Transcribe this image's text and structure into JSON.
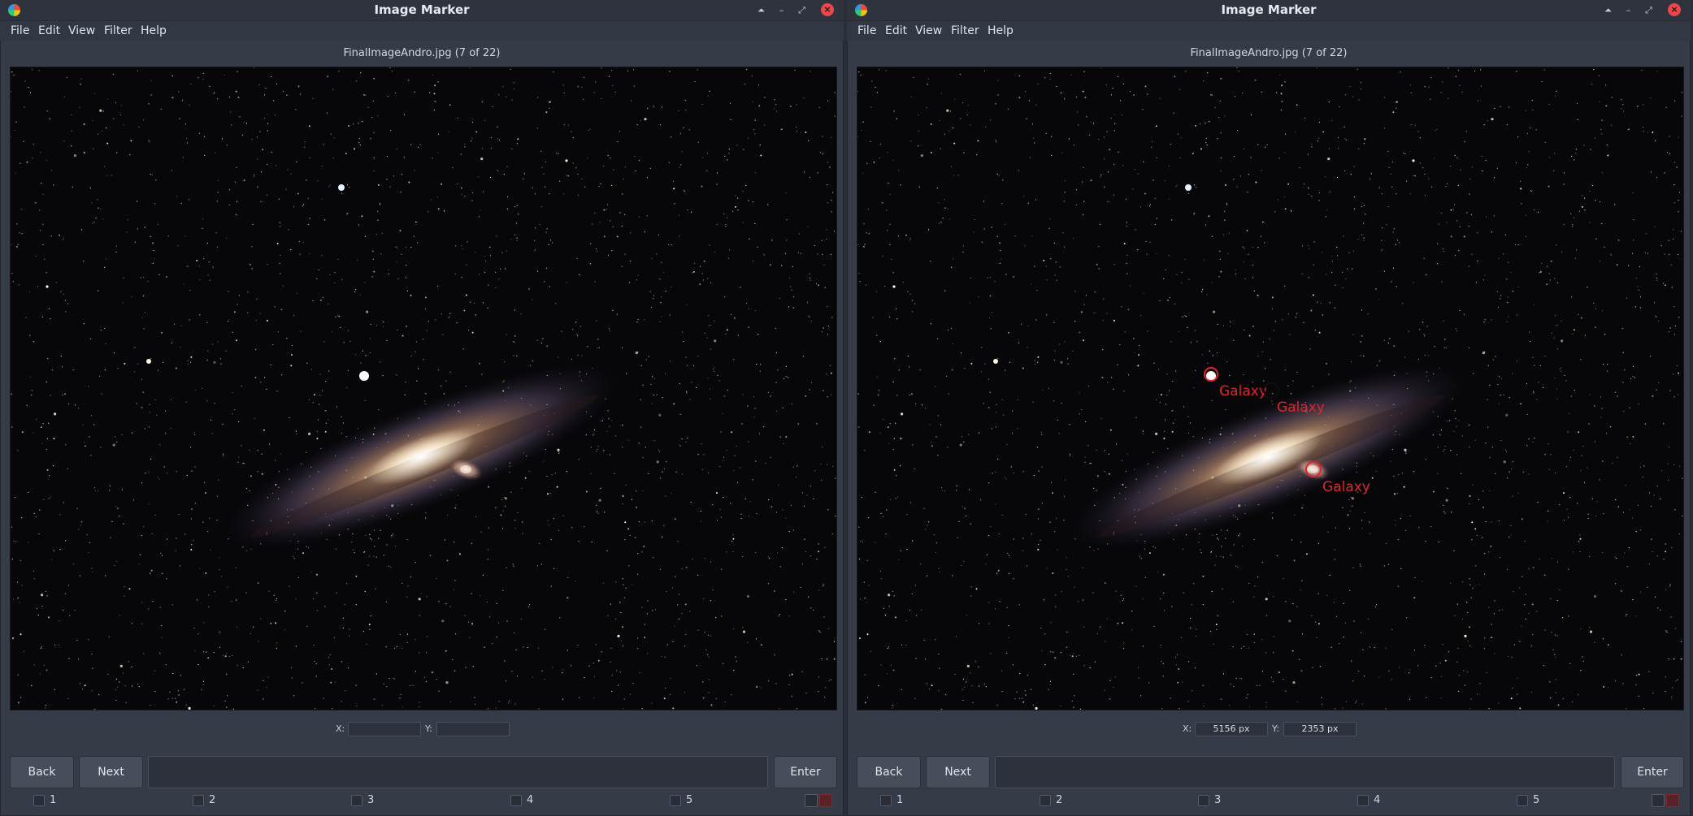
{
  "left_window": {
    "title": "Image Marker",
    "menu": [
      "File",
      "Edit",
      "View",
      "Filter",
      "Help"
    ],
    "filename": "FinalImageAndro.jpg (7 of 22)",
    "coords": {
      "x_label": "X:",
      "y_label": "Y:",
      "x_value": "",
      "y_value": ""
    },
    "buttons": {
      "back": "Back",
      "next": "Next",
      "enter": "Enter"
    },
    "checkboxes": [
      "1",
      "2",
      "3",
      "4",
      "5"
    ]
  },
  "right_window": {
    "title": "Image Marker",
    "menu": [
      "File",
      "Edit",
      "View",
      "Filter",
      "Help"
    ],
    "filename": "FinalImageAndro.jpg (7 of 22)",
    "coords": {
      "x_label": "X:",
      "y_label": "Y:",
      "x_value": "5156 px",
      "y_value": "2353 px"
    },
    "buttons": {
      "back": "Back",
      "next": "Next",
      "enter": "Enter"
    },
    "checkboxes": [
      "1",
      "2",
      "3",
      "4",
      "5"
    ],
    "markers": [
      {
        "label": "Galaxy"
      },
      {
        "label": "Galaxy"
      },
      {
        "label": "Galaxy"
      }
    ]
  },
  "icons": {
    "app": "color-wheel-icon",
    "keep_above": "⏶",
    "minimize": "–",
    "maximize": "⤢",
    "close": "×"
  },
  "colors": {
    "window_bg": "#363b48",
    "marker_red": "#e1232b",
    "marker_cursor": "#111111"
  }
}
